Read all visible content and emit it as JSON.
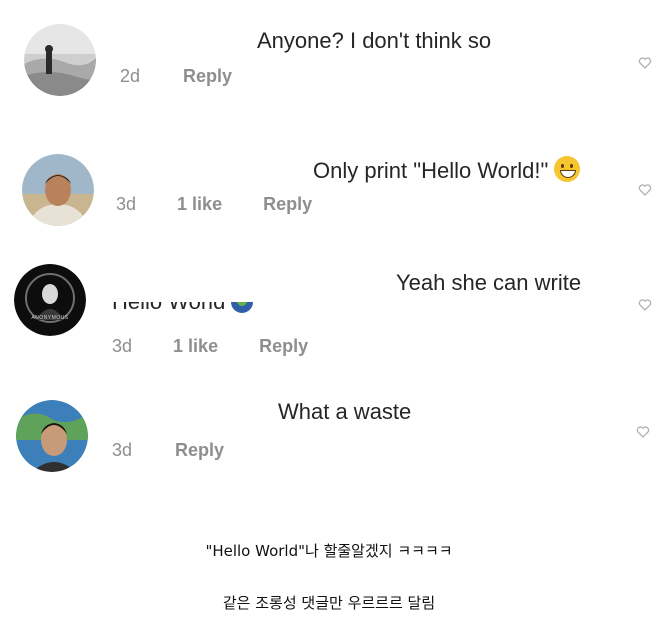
{
  "comments": [
    {
      "text": "Anyone? I don't think so",
      "time": "2d",
      "likes": "",
      "reply_label": "Reply",
      "avatar_desc": "grayscale-photo-avatar"
    },
    {
      "text": "Only print \"Hello World!\"",
      "time": "3d",
      "likes": "1 like",
      "reply_label": "Reply",
      "avatar_desc": "photo-avatar"
    },
    {
      "text": "Yeah she can write",
      "text_line2": "Hello World",
      "time": "3d",
      "likes": "1 like",
      "reply_label": "Reply",
      "avatar_desc": "dark-emblem-avatar",
      "avatar_emblem_text": "ANONYMOUS"
    },
    {
      "text": "What a waste",
      "time": "3d",
      "likes": "",
      "reply_label": "Reply",
      "avatar_desc": "photo-avatar"
    }
  ],
  "caption": {
    "line1": "\"Hello World\"나 할줄알겠지 ㅋㅋㅋㅋ",
    "line2": "같은 조롱성 댓글만 우르르르 달림"
  },
  "colors": {
    "text": "#262626",
    "meta": "#8e8e8e",
    "heart": "#b0b0b0"
  },
  "icons": {
    "emoji": "grinning-face-icon",
    "globe": "globe-icon",
    "like": "heart-outline-icon"
  }
}
